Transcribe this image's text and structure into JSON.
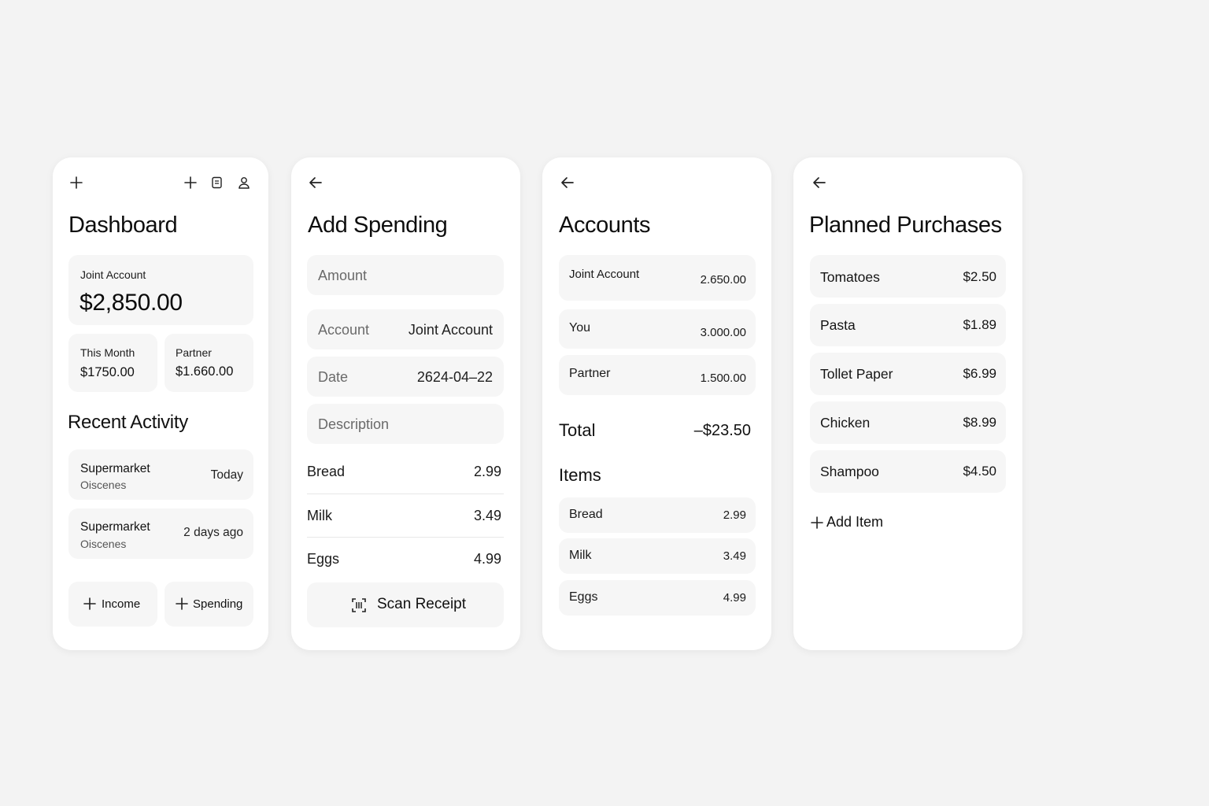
{
  "dashboard": {
    "title": "Dashboard",
    "icons": {
      "left": "plus-icon",
      "right": [
        "plus-icon",
        "receipt-icon",
        "user-icon"
      ]
    },
    "joint_account": {
      "label": "Joint Account",
      "balance": "$2,850.00"
    },
    "this_month": {
      "label": "This Month",
      "value": "$1750.00"
    },
    "partner": {
      "label": "Partner",
      "value": "$1.660.00"
    },
    "recent_activity_title": "Recent Activity",
    "activity": [
      {
        "title": "Supermarket",
        "subtitle": "Oiscenes",
        "when": "Today"
      },
      {
        "title": "Supermarket",
        "subtitle": "Oiscenes",
        "when": "2 days ago"
      }
    ],
    "buttons": {
      "income": "Income",
      "spending": "Spending"
    }
  },
  "add_spending": {
    "title": "Add Spending",
    "amount_placeholder": "Amount",
    "account": {
      "label": "Account",
      "value": "Joint Account"
    },
    "date": {
      "label": "Date",
      "value": "2624-04–22"
    },
    "description_placeholder": "Description",
    "items": [
      {
        "name": "Bread",
        "price": "2.99"
      },
      {
        "name": "Milk",
        "price": "3.49"
      },
      {
        "name": "Eggs",
        "price": "4.99"
      }
    ],
    "scan_button": "Scan Receipt"
  },
  "accounts": {
    "title": "Accounts",
    "rows": [
      {
        "name": "Joint Account",
        "value": "2.650.00"
      },
      {
        "name": "You",
        "value": "3.000.00"
      },
      {
        "name": "Partner",
        "value": "1.500.00"
      }
    ],
    "total_label": "Total",
    "total_value": "–$23.50",
    "items_title": "Items",
    "items": [
      {
        "name": "Bread",
        "price": "2.99"
      },
      {
        "name": "Milk",
        "price": "3.49"
      },
      {
        "name": "Eggs",
        "price": "4.99"
      }
    ]
  },
  "planned": {
    "title": "Planned Purchases",
    "items": [
      {
        "name": "Tomatoes",
        "price": "$2.50"
      },
      {
        "name": "Pasta",
        "price": "$1.89"
      },
      {
        "name": "Tollet Paper",
        "price": "$6.99"
      },
      {
        "name": "Chicken",
        "price": "$8.99"
      },
      {
        "name": "Shampoo",
        "price": "$4.50"
      }
    ],
    "add_item": "Add Item"
  }
}
